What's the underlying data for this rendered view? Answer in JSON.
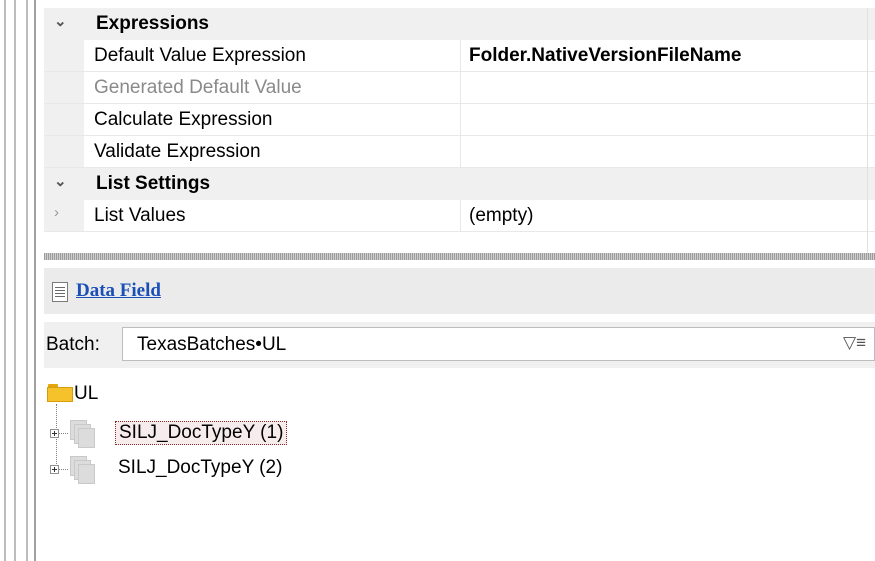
{
  "properties": {
    "categories": [
      {
        "name": "Expressions",
        "rows": [
          {
            "name": "Default Value Expression",
            "value": "Folder.NativeVersionFileName"
          },
          {
            "name": "Generated Default Value",
            "value": ""
          },
          {
            "name": "Calculate Expression",
            "value": ""
          },
          {
            "name": "Validate Expression",
            "value": ""
          }
        ]
      },
      {
        "name": "List Settings",
        "rows": [
          {
            "name": "List Values",
            "value": "(empty)"
          }
        ]
      }
    ],
    "icons": {
      "collapse": "chevron-down-icon",
      "expand": "chevron-right-icon"
    }
  },
  "data_field": {
    "title": "Data Field",
    "icon": "document-icon"
  },
  "batch": {
    "label": "Batch:",
    "value": "TexasBatches•UL",
    "filter_icon": "filter-tree-icon"
  },
  "tree": {
    "root": "UL",
    "items": [
      {
        "label": "SILJ_DocTypeY (1)",
        "selected": true
      },
      {
        "label": "SILJ_DocTypeY (2)",
        "selected": false
      }
    ]
  }
}
